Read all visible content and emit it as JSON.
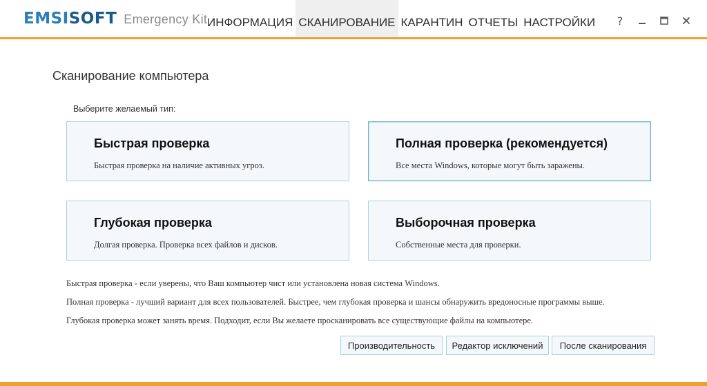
{
  "app": {
    "brand_left": "EMSI",
    "brand_right": "SOFT",
    "product": "Emergency Kit"
  },
  "nav": {
    "items": [
      {
        "label": "ИНФОРМАЦИЯ"
      },
      {
        "label": "СКАНИРОВАНИЕ",
        "active": true
      },
      {
        "label": "КАРАНТИН"
      },
      {
        "label": "ОТЧЕТЫ"
      },
      {
        "label": "НАСТРОЙКИ"
      }
    ]
  },
  "window": {
    "help": "?",
    "minimize": "—",
    "maximize": "☐",
    "close": "✕"
  },
  "main": {
    "title": "Сканирование компьютера",
    "type_prompt": "Выберите желаемый тип:",
    "cards": [
      {
        "title": "Быстрая проверка",
        "desc": "Быстрая проверка на наличие активных угроз."
      },
      {
        "title": "Полная проверка (рекомендуется)",
        "desc": "Все места Windows, которые могут быть заражены."
      },
      {
        "title": "Глубокая проверка",
        "desc": "Долгая проверка. Проверка всех файлов и дисков."
      },
      {
        "title": "Выборочная проверка",
        "desc": "Собственные места для проверки."
      }
    ],
    "notes": [
      "Быстрая проверка - если уверены, что Ваш компьютер чист или установлена новая система Windows.",
      "Полная проверка - лучший вариант для всех пользователей. Быстрее, чем глубокая проверка и шансы обнаружить вредоносные программы выше.",
      "Глубокая проверка может занять время. Подходит, если Вы желаете просканировать все существующие файлы на компьютере."
    ],
    "buttons": {
      "performance": "Производительность",
      "exclusions": "Редактор исключений",
      "after_scan": "После сканирования"
    }
  },
  "colors": {
    "accent": "#f0a030",
    "brand_blue": "#2a7fb8",
    "card_border": "#a9d2de",
    "card_bg": "#f4f8fa"
  }
}
